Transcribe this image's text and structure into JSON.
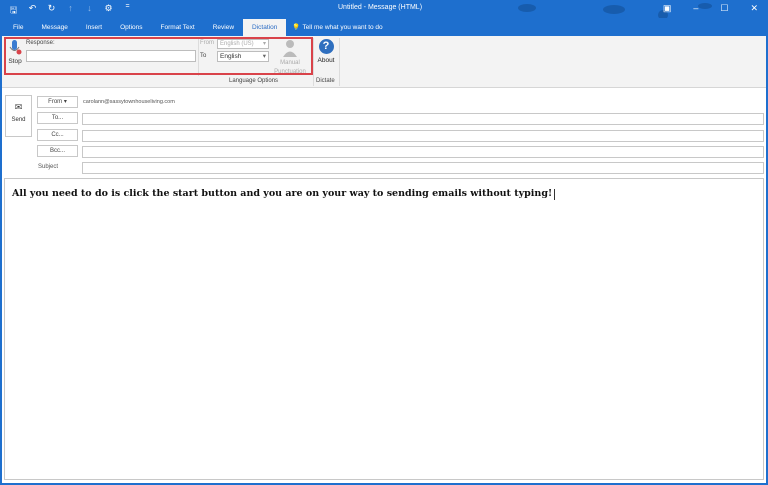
{
  "window": {
    "title": "Untitled  -  Message (HTML)"
  },
  "quick_access": [
    {
      "icon": "save-icon",
      "glyph": "🖫"
    },
    {
      "icon": "undo-icon",
      "glyph": "↶"
    },
    {
      "icon": "redo-icon",
      "glyph": "↻"
    },
    {
      "icon": "up-arrow-icon",
      "glyph": "↑"
    },
    {
      "icon": "down-arrow-icon",
      "glyph": "↓"
    },
    {
      "icon": "customize-icon",
      "glyph": "⚙"
    },
    {
      "icon": "more-icon",
      "glyph": "="
    }
  ],
  "tabs": [
    "File",
    "Message",
    "Insert",
    "Options",
    "Format Text",
    "Review",
    "Dictation"
  ],
  "active_tab": "Dictation",
  "tell_me": "Tell me what you want to do",
  "ribbon": {
    "stop": "Stop",
    "response_label": "Response:",
    "from_label": "From",
    "from_value": "English (US)",
    "to_label": "To",
    "to_value": "English",
    "manual_punctuation": "Manual Punctuation",
    "group_language": "Language Options",
    "about": "About",
    "group_dictate": "Dictate"
  },
  "compose": {
    "send": "Send",
    "from_button": "From ▾",
    "from_address": "carolann@sassytownhouseliving.com",
    "to_button": "To...",
    "cc_button": "Cc...",
    "bcc_button": "Bcc...",
    "subject_label": "Subject",
    "body_text": "All you need to do is click the start button and you are on your way to sending emails without typing!"
  },
  "colors": {
    "accent": "#1e6fce",
    "highlight": "#d9434a"
  }
}
